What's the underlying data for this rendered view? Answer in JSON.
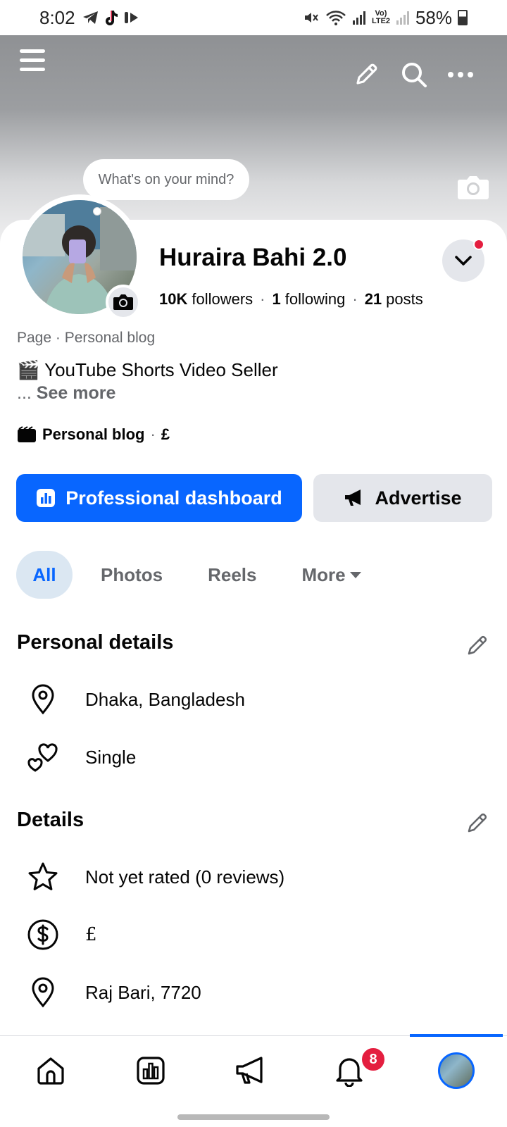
{
  "status_bar": {
    "time": "8:02",
    "battery": "58%",
    "network": "Vo) LTE2",
    "app_icons": [
      "telegram-icon",
      "tiktok-icon",
      "play-icon"
    ]
  },
  "cover": {
    "thought_bubble": "What's on your mind?"
  },
  "profile": {
    "name": "Huraira Bahi 2.0",
    "followers_count": "10K",
    "followers_label": "followers",
    "following_count": "1",
    "following_label": "following",
    "posts_count": "21",
    "posts_label": "posts",
    "stats_separator": "·",
    "category": "Page · Personal blog",
    "bio": "🎬 YouTube Shorts Video Seller",
    "see_more_prefix": "...",
    "see_more": "See more",
    "blog_label": "Personal blog",
    "blog_dot": "·",
    "currency": "£"
  },
  "actions": {
    "primary": "Professional dashboard",
    "secondary": "Advertise"
  },
  "tabs": [
    {
      "label": "All",
      "active": true
    },
    {
      "label": "Photos",
      "active": false
    },
    {
      "label": "Reels",
      "active": false
    },
    {
      "label": "More",
      "active": false
    }
  ],
  "personal_details": {
    "title": "Personal details",
    "items": [
      {
        "icon": "location-pin-icon",
        "text": "Dhaka, Bangladesh"
      },
      {
        "icon": "hearts-icon",
        "text": "Single"
      }
    ]
  },
  "details": {
    "title": "Details",
    "items": [
      {
        "icon": "star-icon",
        "text": "Not yet rated (0 reviews)"
      },
      {
        "icon": "dollar-icon",
        "text": "£"
      },
      {
        "icon": "location-pin-icon",
        "text": "Raj Bari, 7720"
      }
    ]
  },
  "bottom_nav": {
    "notification_badge": "8",
    "items": [
      "home-icon",
      "dashboard-icon",
      "megaphone-icon",
      "bell-icon",
      "profile-avatar"
    ]
  },
  "colors": {
    "brand_blue": "#0866ff",
    "secondary_gray": "#e4e6eb",
    "badge_red": "#e41e3f",
    "muted_text": "#65676b"
  }
}
